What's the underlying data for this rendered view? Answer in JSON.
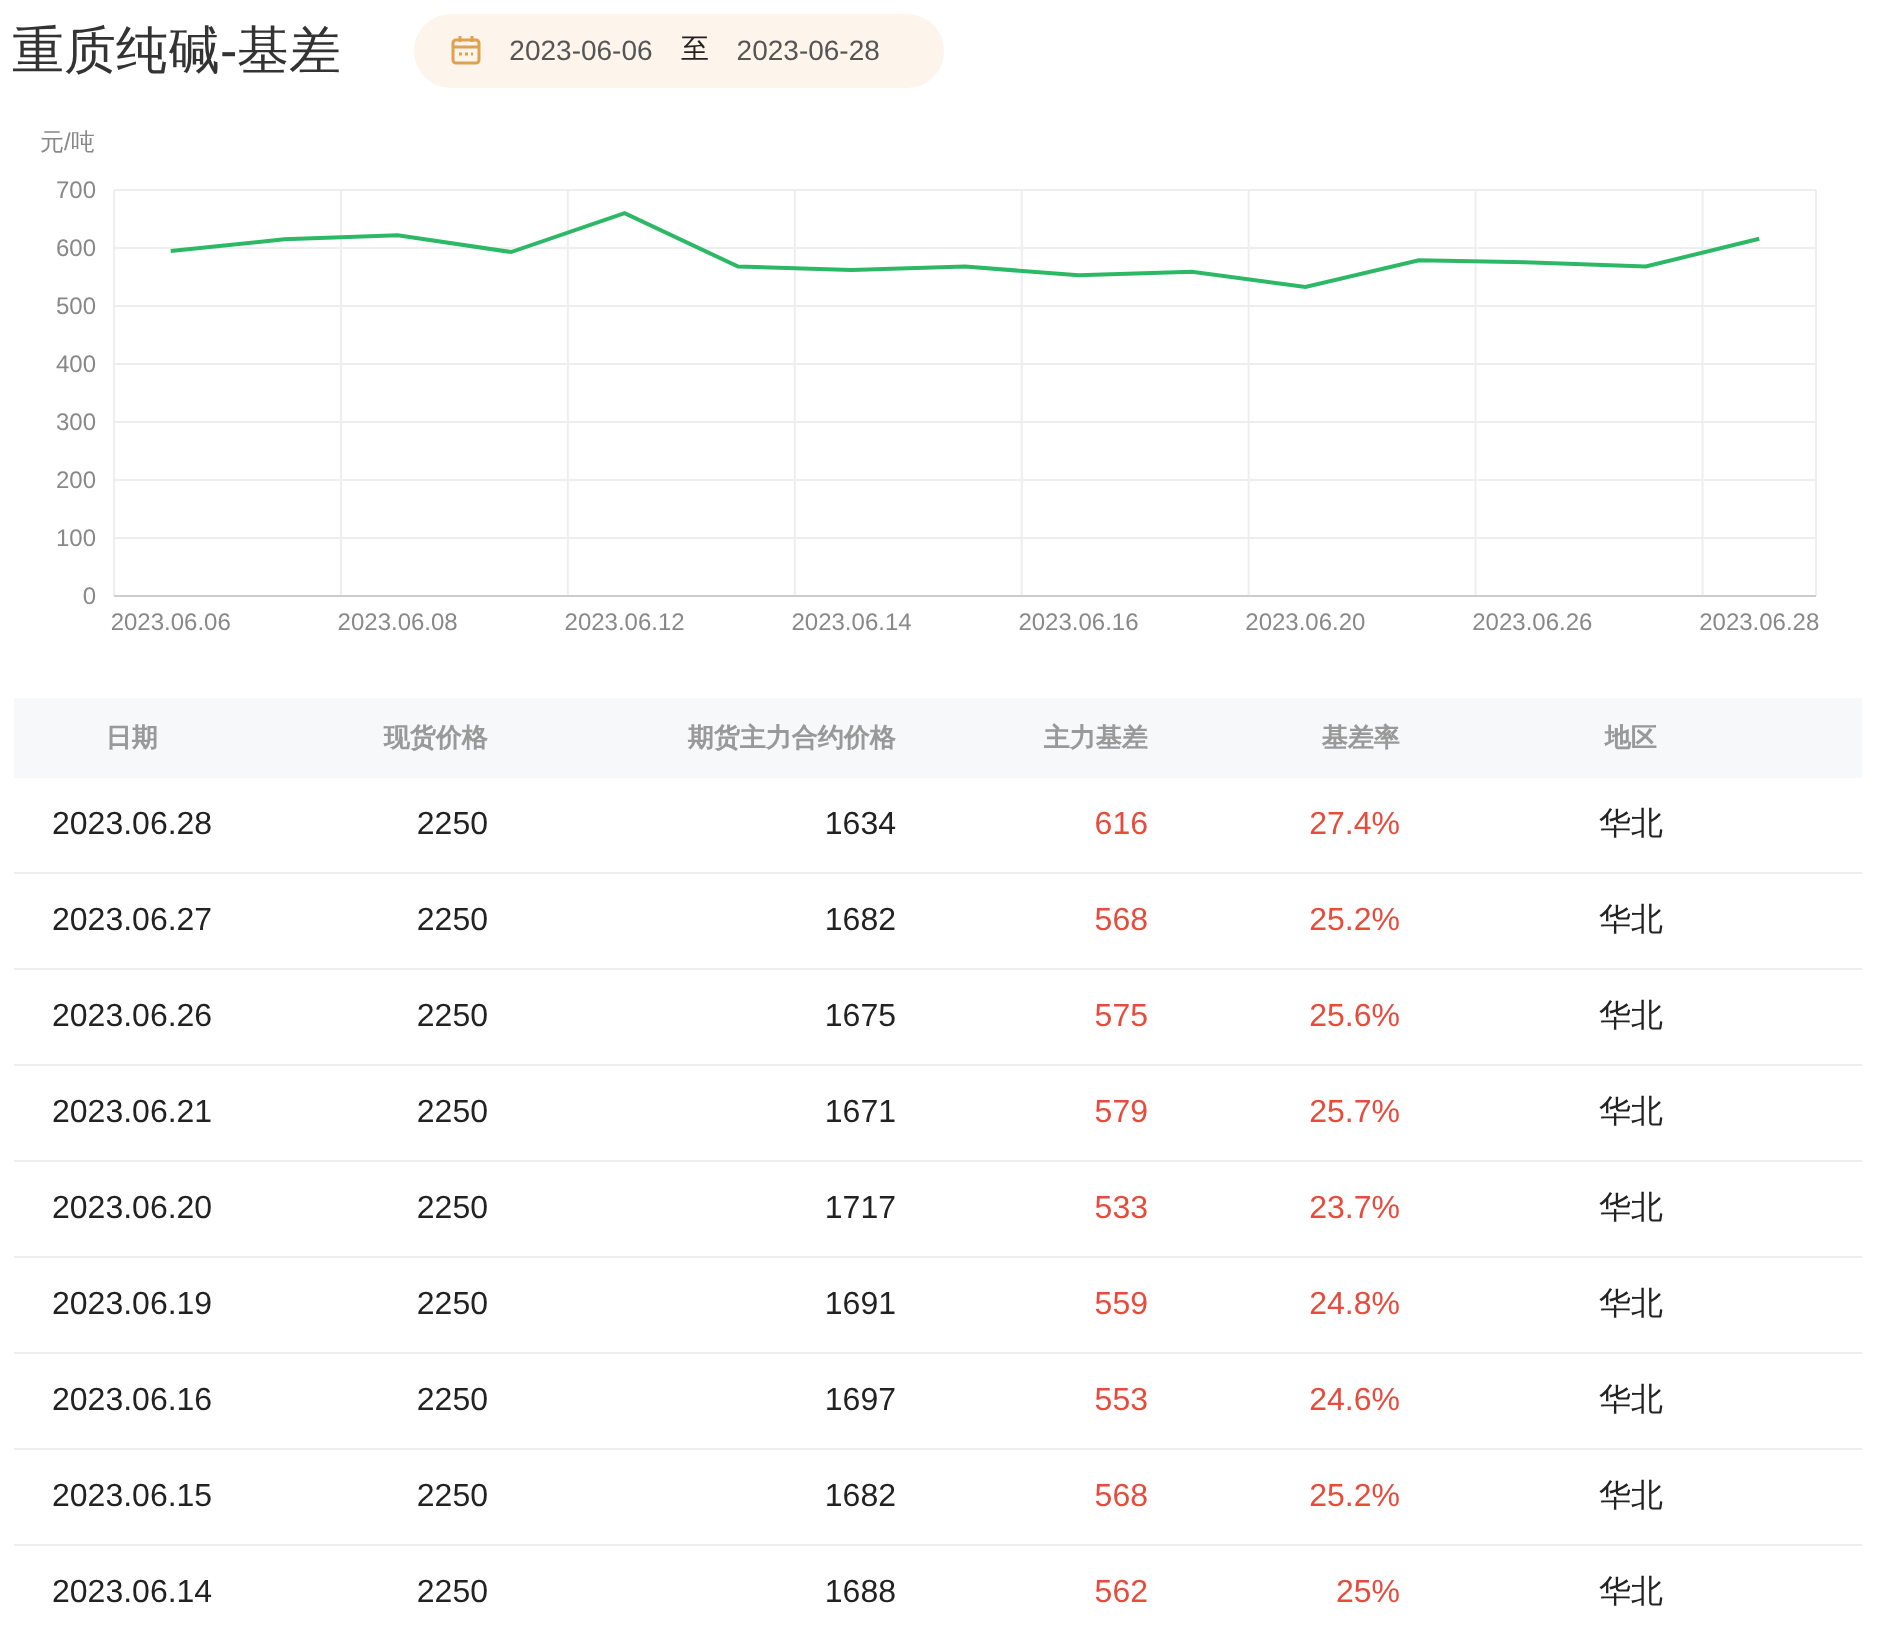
{
  "title": "重质纯碱-基差",
  "date_range": {
    "start": "2023-06-06",
    "separator": "至",
    "end": "2023-06-28"
  },
  "chart": {
    "chart_data": {
      "type": "line",
      "ylabel": "元/吨",
      "grid": true,
      "categories": [
        "2023.06.06",
        null,
        "2023.06.08",
        null,
        "2023.06.12",
        null,
        "2023.06.14",
        null,
        "2023.06.16",
        null,
        "2023.06.20",
        null,
        "2023.06.26",
        null,
        "2023.06.28"
      ],
      "series": [
        {
          "color": "#2db866",
          "values": [
            595,
            615,
            622,
            593,
            660,
            568,
            562,
            568,
            553,
            559,
            533,
            579,
            575,
            568,
            616
          ]
        }
      ],
      "ylim": [
        0,
        700
      ],
      "yticks": [
        0,
        100,
        200,
        300,
        400,
        500,
        600,
        700
      ]
    }
  },
  "table": {
    "columns": [
      {
        "label": "日期",
        "kind": "date"
      },
      {
        "label": "现货价格",
        "kind": "number"
      },
      {
        "label": "期货主力合约价格",
        "kind": "number"
      },
      {
        "label": "主力基差",
        "kind": "highlight"
      },
      {
        "label": "基差率",
        "kind": "highlight"
      },
      {
        "label": "地区",
        "kind": "region"
      }
    ],
    "rows": [
      [
        "2023.06.28",
        "2250",
        "1634",
        "616",
        "27.4%",
        "华北"
      ],
      [
        "2023.06.27",
        "2250",
        "1682",
        "568",
        "25.2%",
        "华北"
      ],
      [
        "2023.06.26",
        "2250",
        "1675",
        "575",
        "25.6%",
        "华北"
      ],
      [
        "2023.06.21",
        "2250",
        "1671",
        "579",
        "25.7%",
        "华北"
      ],
      [
        "2023.06.20",
        "2250",
        "1717",
        "533",
        "23.7%",
        "华北"
      ],
      [
        "2023.06.19",
        "2250",
        "1691",
        "559",
        "24.8%",
        "华北"
      ],
      [
        "2023.06.16",
        "2250",
        "1697",
        "553",
        "24.6%",
        "华北"
      ],
      [
        "2023.06.15",
        "2250",
        "1682",
        "568",
        "25.2%",
        "华北"
      ],
      [
        "2023.06.14",
        "2250",
        "1688",
        "562",
        "25%",
        "华北"
      ]
    ]
  }
}
